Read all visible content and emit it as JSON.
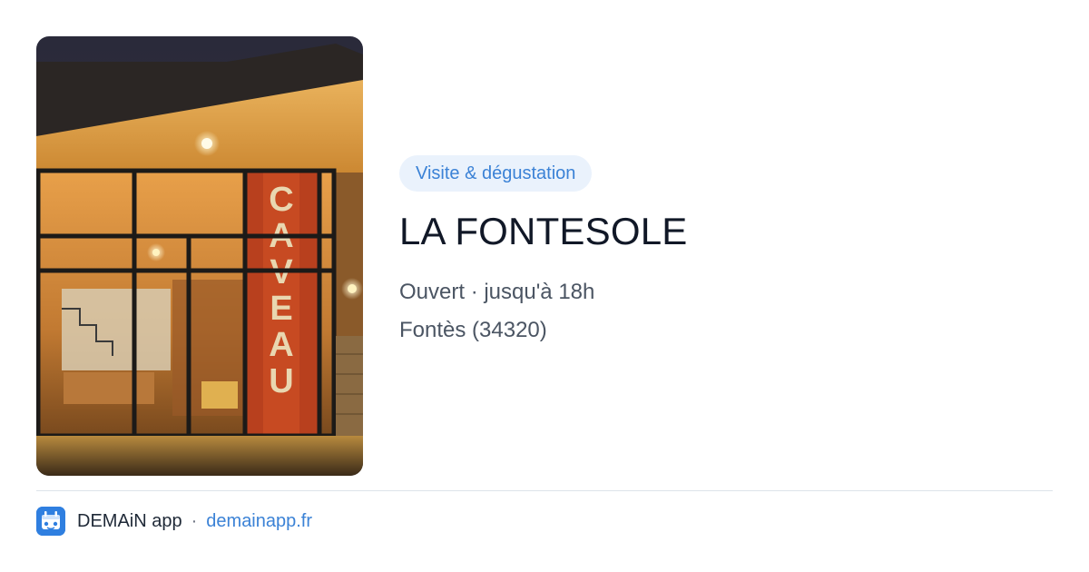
{
  "card": {
    "image_alt": "Caveau La Fontesole",
    "image_sign": "CAVEAU",
    "category": "Visite & dégustation",
    "title": "LA FONTESOLE",
    "status": "Ouvert · jusqu'à 18h",
    "location": "Fontès (34320)"
  },
  "footer": {
    "app_icon": "demain-app-icon",
    "app_name": "DEMAiN app",
    "separator": "·",
    "domain": "demainapp.fr"
  },
  "colors": {
    "accent": "#3b82d6",
    "pill_bg": "#eaf2fc",
    "title": "#111827",
    "muted": "#4b5563",
    "divider": "#dde3ea"
  }
}
